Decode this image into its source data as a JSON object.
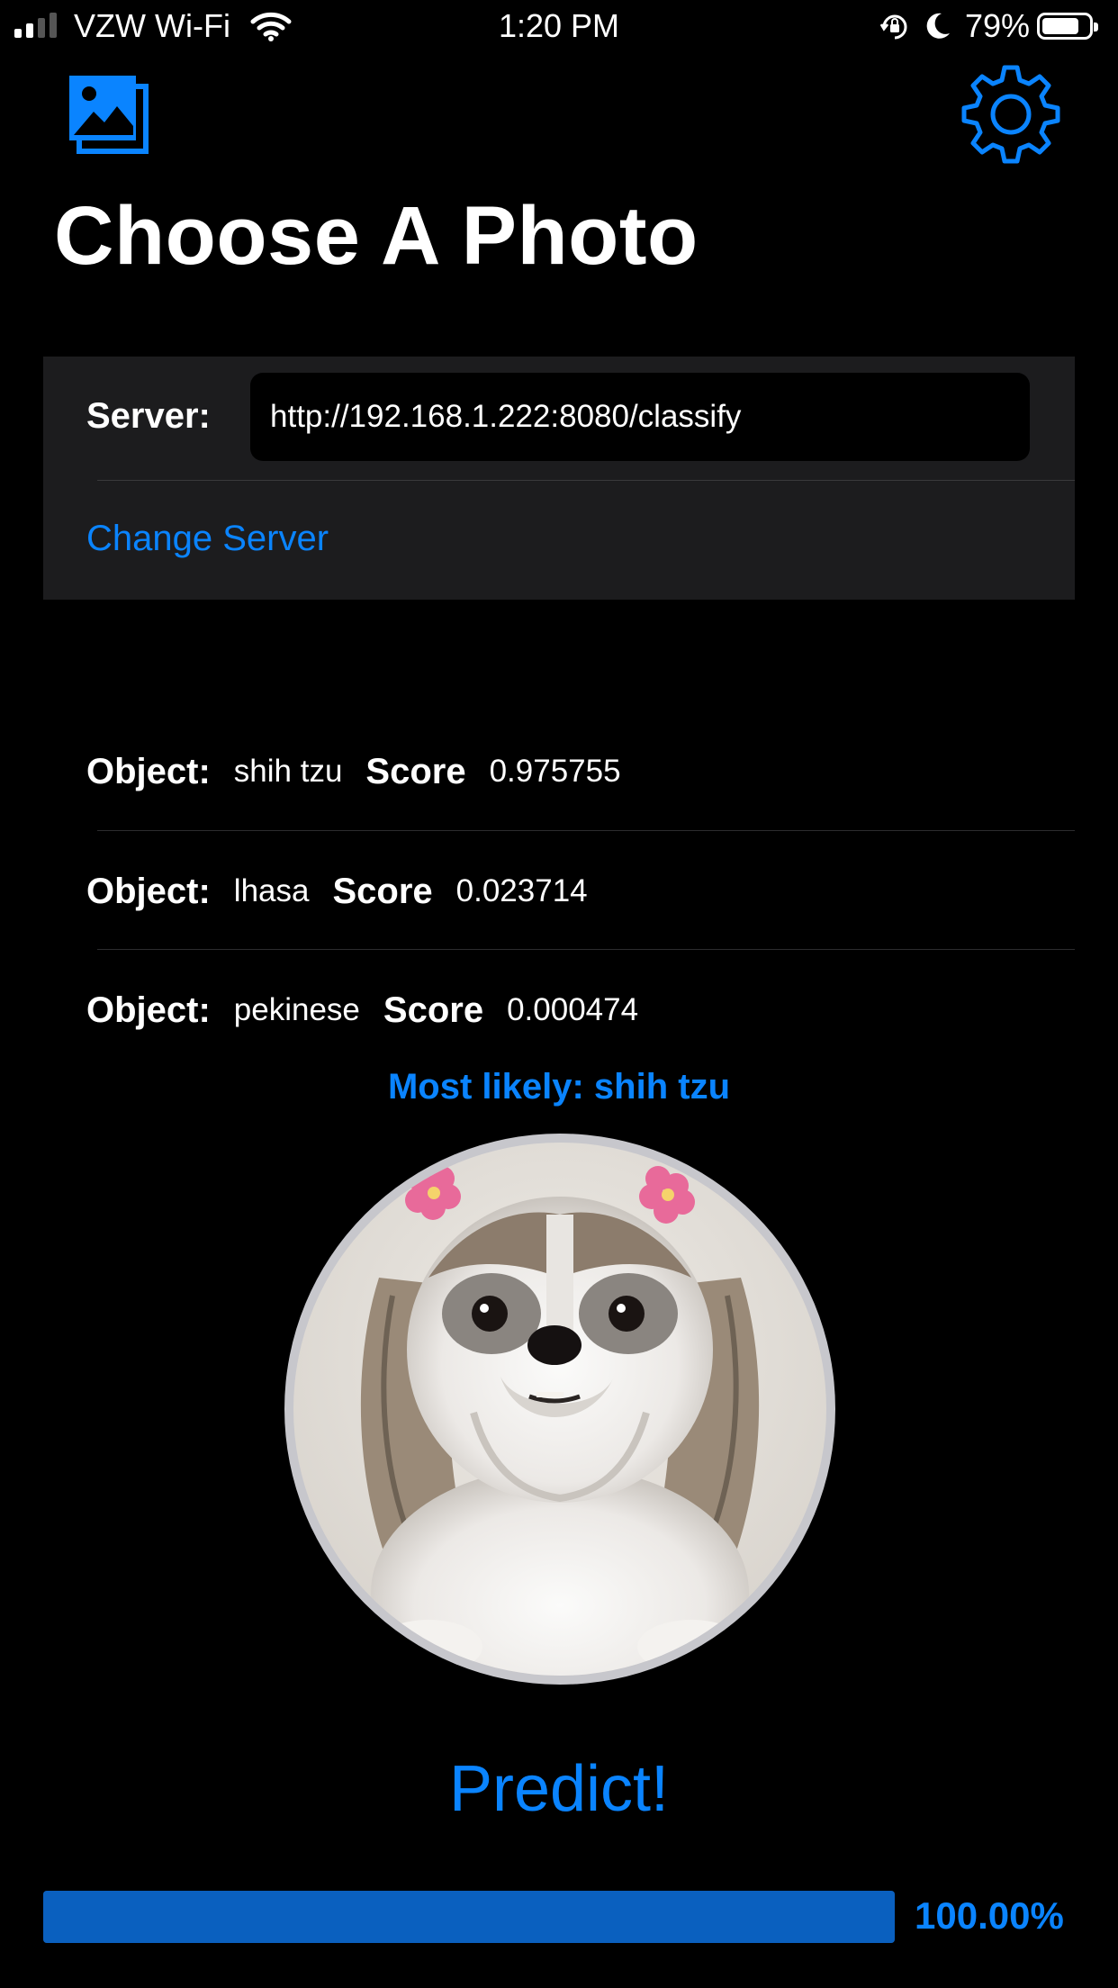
{
  "status_bar": {
    "carrier": "VZW Wi-Fi",
    "time": "1:20 PM",
    "battery_percent": "79%",
    "battery_level": 0.79,
    "icons": [
      "signal-icon",
      "wifi-icon",
      "rotation-lock-icon",
      "moon-icon",
      "battery-icon"
    ]
  },
  "toolbar": {
    "left_icon": "photos-icon",
    "right_icon": "gear-icon"
  },
  "page": {
    "title": "Choose A Photo"
  },
  "server": {
    "label": "Server:",
    "value": "http://192.168.1.222:8080/classify",
    "change_label": "Change Server"
  },
  "results": [
    {
      "object_label": "Object:",
      "object": "shih tzu",
      "score_label": "Score",
      "score": "0.975755"
    },
    {
      "object_label": "Object:",
      "object": "lhasa",
      "score_label": "Score",
      "score": "0.023714"
    },
    {
      "object_label": "Object:",
      "object": "pekinese",
      "score_label": "Score",
      "score": "0.000474"
    }
  ],
  "most_likely": "Most likely: shih tzu",
  "predict_label": "Predict!",
  "progress": {
    "value": 1.0,
    "text": "100.00%"
  },
  "colors": {
    "accent": "#0a84ff",
    "background": "#000000",
    "card": "#1c1c1e"
  }
}
